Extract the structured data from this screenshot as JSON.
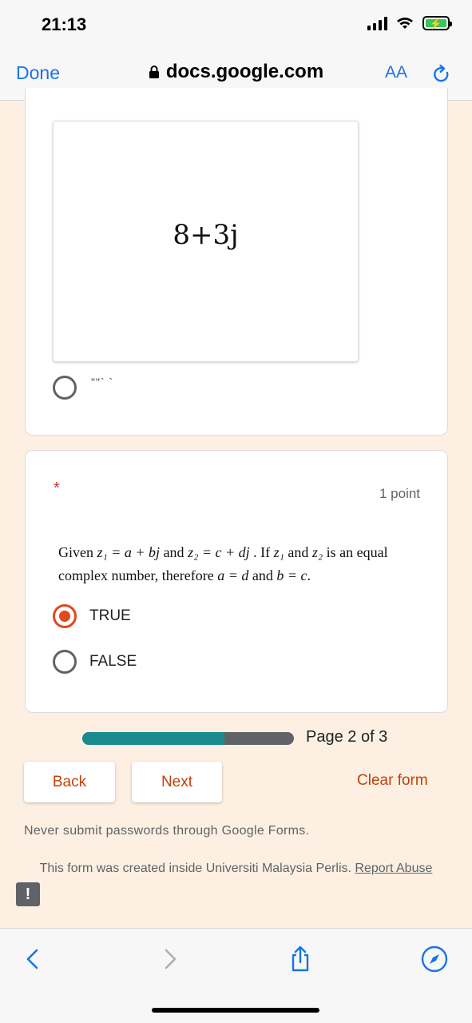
{
  "status": {
    "time": "21:13"
  },
  "browser": {
    "done_label": "Done",
    "domain": "docs.google.com",
    "text_size_label": "AA"
  },
  "question_prev": {
    "image_expression": "8+3j",
    "option_mark": "\"\"` `"
  },
  "question": {
    "required_mark": "*",
    "points": "1 point",
    "line1_a": "Given ",
    "line1_b": "z₁ = a + bj",
    "line1_c": " and ",
    "line1_d": "z₂ = c + dj",
    "line1_e": " . If ",
    "line1_f": "z₁",
    "line1_g": " and ",
    "line1_h": "z₂",
    "line1_i": " is an equal",
    "line2_a": "complex number, therefore ",
    "line2_b": "a = d",
    "line2_c": " and ",
    "line2_d": "b = c",
    "line2_e": ".",
    "options": [
      {
        "label": "TRUE",
        "selected": true
      },
      {
        "label": "FALSE",
        "selected": false
      }
    ]
  },
  "progress": {
    "fraction": 0.67,
    "page_text": "Page 2 of 3"
  },
  "buttons": {
    "back": "Back",
    "next": "Next",
    "clear": "Clear form"
  },
  "footer": {
    "warning": "Never submit passwords through Google Forms.",
    "created": "This form was created inside Universiti Malaysia Perlis. ",
    "report": "Report Abuse",
    "feedback_icon": "!"
  },
  "colors": {
    "accent": "#c2410c",
    "progress": "#1b8a8f",
    "link": "#1a73e8"
  }
}
